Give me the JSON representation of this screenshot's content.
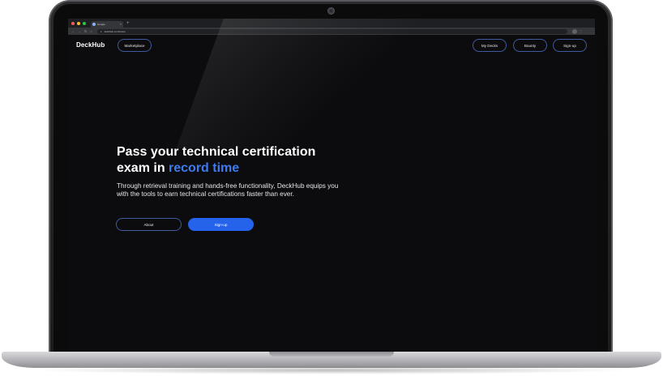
{
  "browser": {
    "tab_title": "Google",
    "tab_close": "×",
    "new_tab": "+",
    "url": "deckhub.com/home",
    "nav_back": "←",
    "nav_forward": "→",
    "nav_reload": "↻",
    "nav_home": "⌂",
    "menu": "⋮"
  },
  "header": {
    "logo": "DeckHub",
    "nav_left": [
      {
        "label": "Marketplace"
      }
    ],
    "nav_right": [
      {
        "label": "My Decks"
      },
      {
        "label": "Bounty"
      },
      {
        "label": "Sign-up"
      }
    ]
  },
  "hero": {
    "title_line1": "Pass your technical certification",
    "title_line2_prefix": "exam in ",
    "title_accent": "record time",
    "subtitle": "Through retrieval training and hands-free functionality, DeckHub equips you with the tools to earn technical certifications faster than ever.",
    "about_label": "About",
    "signup_label": "Sign-up"
  },
  "colors": {
    "accent": "#3d7bf0",
    "primary_button": "#2563eb",
    "background": "#0c0c0e",
    "pill_border": "#3f5b9c"
  },
  "icons": {
    "camera": "camera-icon",
    "lock": "lock-icon",
    "profile": "profile-avatar-icon"
  }
}
